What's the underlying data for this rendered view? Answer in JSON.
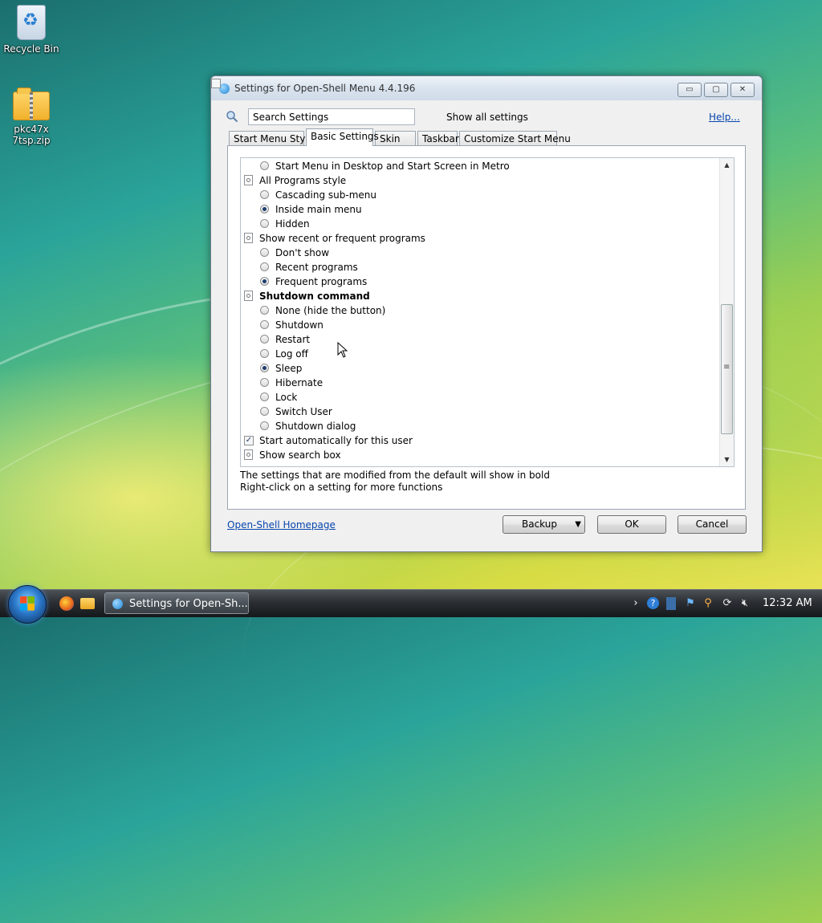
{
  "desktop": {
    "icons": [
      {
        "label": "Recycle Bin"
      },
      {
        "label": "pkc47x\n7tsp.zip"
      }
    ]
  },
  "window": {
    "title": "Settings for Open-Shell Menu 4.4.196",
    "controls": {
      "minimize": "▭",
      "maximize": "▢",
      "close": "✕"
    }
  },
  "search": {
    "value": "Search Settings"
  },
  "show_all": {
    "label": "Show all settings",
    "checked": false
  },
  "help_link": "Help...",
  "tabs": [
    {
      "label": "Start Menu Style",
      "active": false
    },
    {
      "label": "Basic Settings",
      "active": true
    },
    {
      "label": "Skin",
      "active": false
    },
    {
      "label": "Taskbar",
      "active": false
    },
    {
      "label": "Customize Start Menu",
      "active": false
    }
  ],
  "settings": [
    {
      "kind": "radio",
      "level": 1,
      "label": "Start Menu in Desktop and Start Screen in Metro",
      "selected": false
    },
    {
      "kind": "category",
      "level": 0,
      "label": "All Programs style",
      "bold": false
    },
    {
      "kind": "radio",
      "level": 1,
      "label": "Cascading sub-menu",
      "selected": false
    },
    {
      "kind": "radio",
      "level": 1,
      "label": "Inside main menu",
      "selected": true
    },
    {
      "kind": "radio",
      "level": 1,
      "label": "Hidden",
      "selected": false
    },
    {
      "kind": "category",
      "level": 0,
      "label": "Show recent or frequent programs",
      "bold": false
    },
    {
      "kind": "radio",
      "level": 1,
      "label": "Don't show",
      "selected": false
    },
    {
      "kind": "radio",
      "level": 1,
      "label": "Recent programs",
      "selected": false
    },
    {
      "kind": "radio",
      "level": 1,
      "label": "Frequent programs",
      "selected": true
    },
    {
      "kind": "category",
      "level": 0,
      "label": "Shutdown command",
      "bold": true
    },
    {
      "kind": "radio",
      "level": 1,
      "label": "None (hide the button)",
      "selected": false
    },
    {
      "kind": "radio",
      "level": 1,
      "label": "Shutdown",
      "selected": false
    },
    {
      "kind": "radio",
      "level": 1,
      "label": "Restart",
      "selected": false
    },
    {
      "kind": "radio",
      "level": 1,
      "label": "Log off",
      "selected": false
    },
    {
      "kind": "radio",
      "level": 1,
      "label": "Sleep",
      "selected": true
    },
    {
      "kind": "radio",
      "level": 1,
      "label": "Hibernate",
      "selected": false
    },
    {
      "kind": "radio",
      "level": 1,
      "label": "Lock",
      "selected": false
    },
    {
      "kind": "radio",
      "level": 1,
      "label": "Switch User",
      "selected": false
    },
    {
      "kind": "radio",
      "level": 1,
      "label": "Shutdown dialog",
      "selected": false
    },
    {
      "kind": "checkbox",
      "level": 0,
      "label": "Start automatically for this user",
      "checked": true
    },
    {
      "kind": "category",
      "level": 0,
      "label": "Show search box",
      "bold": false
    }
  ],
  "info": {
    "line1": "The settings that are modified from the default will show in bold",
    "line2": "Right-click on a setting for more functions"
  },
  "footer": {
    "homepage": "Open-Shell Homepage",
    "backup": "Backup",
    "ok": "OK",
    "cancel": "Cancel"
  },
  "taskbar": {
    "task_label": "Settings for Open-Sh...",
    "clock": "12:32 AM",
    "tray_icons": [
      "chevron-right-icon",
      "help-icon",
      "network-icon",
      "flag-icon",
      "search-icon",
      "refresh-icon",
      "volume-muted-icon"
    ]
  },
  "colors": {
    "link": "#0645ad",
    "accent": "#1f86d6"
  }
}
